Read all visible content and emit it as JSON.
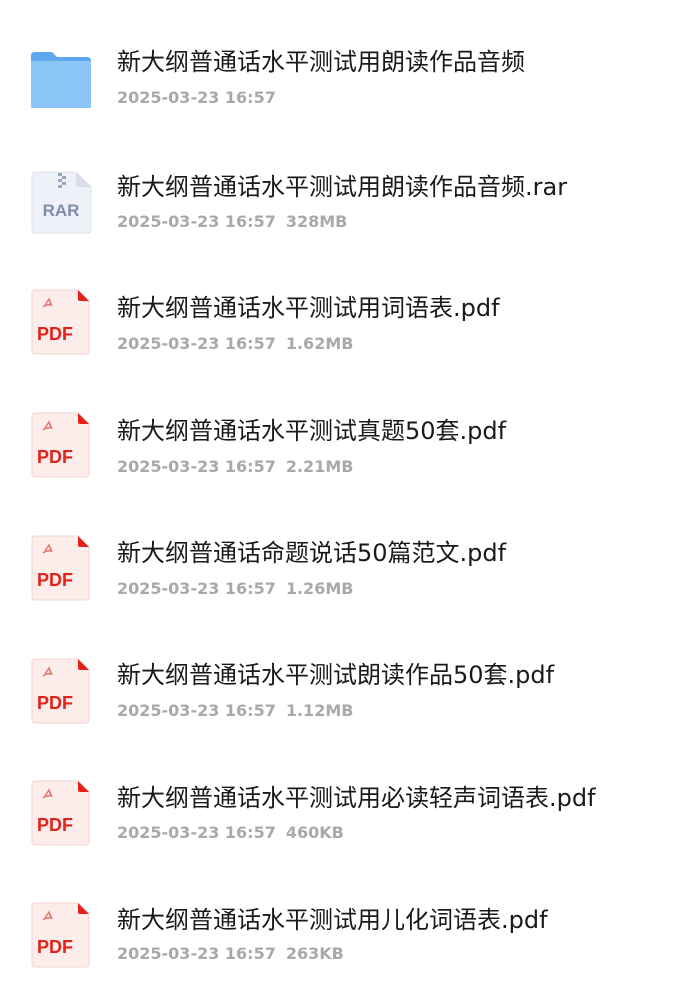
{
  "files": [
    {
      "type": "folder",
      "icon": "folder-icon",
      "name": "新大纲普通话水平测试用朗读作品音频",
      "date": "2025-03-23 16:57",
      "size": ""
    },
    {
      "type": "rar",
      "icon": "rar-archive-icon",
      "icon_label": "RAR",
      "name": "新大纲普通话水平测试用朗读作品音频.rar",
      "date": "2025-03-23 16:57",
      "size": "328MB"
    },
    {
      "type": "pdf",
      "icon": "pdf-file-icon",
      "icon_label": "PDF",
      "name": "新大纲普通话水平测试用词语表.pdf",
      "date": "2025-03-23 16:57",
      "size": "1.62MB"
    },
    {
      "type": "pdf",
      "icon": "pdf-file-icon",
      "icon_label": "PDF",
      "name": "新大纲普通话水平测试真题50套.pdf",
      "date": "2025-03-23 16:57",
      "size": "2.21MB"
    },
    {
      "type": "pdf",
      "icon": "pdf-file-icon",
      "icon_label": "PDF",
      "name": "新大纲普通话命题说话50篇范文.pdf",
      "date": "2025-03-23 16:57",
      "size": "1.26MB"
    },
    {
      "type": "pdf",
      "icon": "pdf-file-icon",
      "icon_label": "PDF",
      "name": "新大纲普通话水平测试朗读作品50套.pdf",
      "date": "2025-03-23 16:57",
      "size": "1.12MB"
    },
    {
      "type": "pdf",
      "icon": "pdf-file-icon",
      "icon_label": "PDF",
      "name": "新大纲普通话水平测试用必读轻声词语表.pdf",
      "date": "2025-03-23 16:57",
      "size": "460KB"
    },
    {
      "type": "pdf",
      "icon": "pdf-file-icon",
      "icon_label": "PDF",
      "name": "新大纲普通话水平测试用儿化词语表.pdf",
      "date": "2025-03-23 16:57",
      "size": "263KB"
    }
  ],
  "colors": {
    "folder": "#6fb4f5",
    "pdf_accent": "#e2231a",
    "rar_label": "#7f8fab",
    "meta_text": "#a9a9a9",
    "name_text": "#1a1a1a"
  }
}
